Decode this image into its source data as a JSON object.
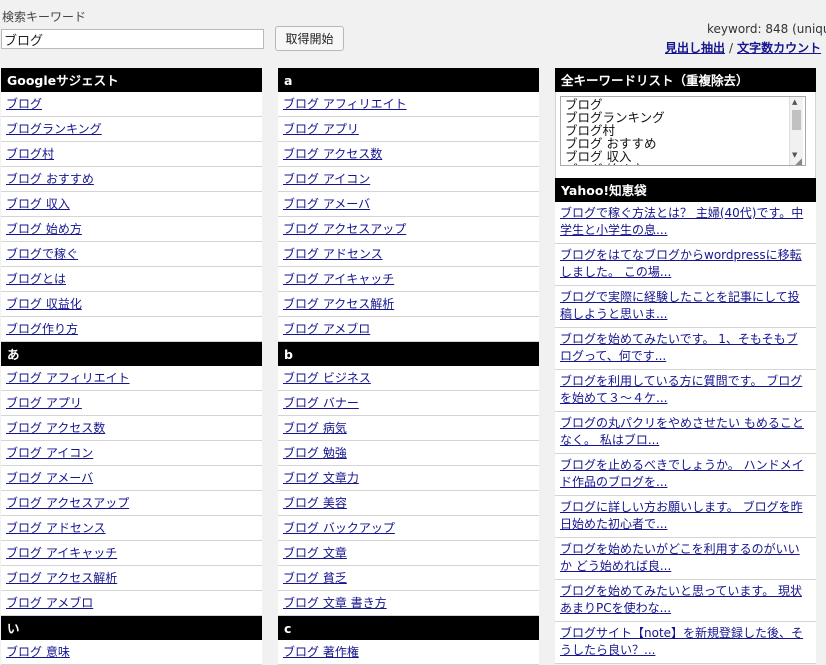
{
  "search": {
    "label": "検索キーワード",
    "value": "ブログ",
    "button": "取得開始"
  },
  "header": {
    "keyword_count": "keyword: 848 (uniqu",
    "link_headings": "見出し抽出",
    "separator": "/",
    "link_charcount": "文字数カウント"
  },
  "col1": {
    "sections": [
      {
        "title": "Googleサジェスト",
        "items": [
          "ブログ",
          "ブログランキング",
          "ブログ村",
          "ブログ おすすめ",
          "ブログ 収入",
          "ブログ 始め方",
          "ブログで稼ぐ",
          "ブログとは",
          "ブログ 収益化",
          "ブログ作り方"
        ]
      },
      {
        "title": "あ",
        "items": [
          "ブログ アフィリエイト",
          "ブログ アプリ",
          "ブログ アクセス数",
          "ブログ アイコン",
          "ブログ アメーバ",
          "ブログ アクセスアップ",
          "ブログ アドセンス",
          "ブログ アイキャッチ",
          "ブログ アクセス解析",
          "ブログ アメブロ"
        ]
      },
      {
        "title": "い",
        "items": [
          "ブログ 意味"
        ]
      }
    ]
  },
  "col2": {
    "sections": [
      {
        "title": "a",
        "items": [
          "ブログ アフィリエイト",
          "ブログ アプリ",
          "ブログ アクセス数",
          "ブログ アイコン",
          "ブログ アメーバ",
          "ブログ アクセスアップ",
          "ブログ アドセンス",
          "ブログ アイキャッチ",
          "ブログ アクセス解析",
          "ブログ アメブロ"
        ]
      },
      {
        "title": "b",
        "items": [
          "ブログ ビジネス",
          "ブログ バナー",
          "ブログ 病気",
          "ブログ 勉強",
          "ブログ 文章力",
          "ブログ 美容",
          "ブログ バックアップ",
          "ブログ 文章",
          "ブログ 貧乏",
          "ブログ 文章 書き方"
        ]
      },
      {
        "title": "c",
        "items": [
          "ブログ 著作権"
        ]
      }
    ]
  },
  "col3": {
    "list_title": "全キーワードリスト（重複除去）",
    "list_text": "ブログ\nブログランキング\nブログ村\nブログ おすすめ\nブログ 収入\nブログ 始め方",
    "yahoo_title": "Yahoo!知恵袋",
    "yahoo_items": [
      [
        "ブログで稼ぐ方法とは？ 主婦(40代)です。中",
        "学生と小学生の息..."
      ],
      [
        "ブログをはてなブログからwordpressに移転",
        "しました。 この場..."
      ],
      [
        "ブログで実際に経験したことを記事にして投",
        "稿しようと思いま..."
      ],
      [
        "ブログを始めてみたいです。 1、そもそもブ",
        "ログって、何です..."
      ],
      [
        "ブログを利用している方に質問です。 ブログ",
        "を始めて３～４ケ..."
      ],
      [
        "ブログの丸パクリをやめさせたい もめること",
        "なく。 私はブロ..."
      ],
      [
        "ブログを止めるべきでしょうか。 ハンドメイ",
        "ド作品のブログを..."
      ],
      [
        "ブログに詳しい方お願いします。 ブログを昨",
        "日始めた初心者で..."
      ],
      [
        "ブログを始めたいがどこを利用するのがいい",
        "か どう始めれば良..."
      ],
      [
        "ブログを始めてみたいと思っています。 現状",
        "あまりPCを使わな..."
      ],
      [
        "ブログサイト【note】を新規登録した後、そ",
        "うしたら良い？..."
      ]
    ]
  }
}
